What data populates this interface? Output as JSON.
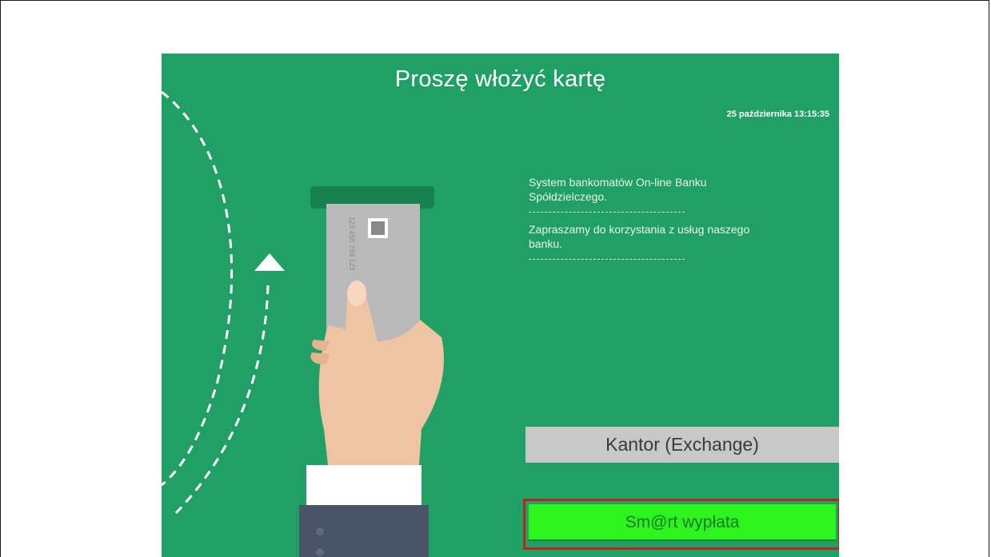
{
  "screen": {
    "title": "Proszę włożyć kartę",
    "datetime": "25 października 13:15:35",
    "info_line1": "System bankomatów On-line Banku Spółdzielczego.",
    "info_line2": "Zapraszamy do korzystania z usług naszego banku.",
    "card_number": "123 456 789 123"
  },
  "buttons": {
    "exchange_label": "Kantor (Exchange)",
    "smart_label": "Sm@rt wypłata"
  },
  "colors": {
    "screen_bg": "#21a065",
    "exchange_button": "#c8c8c8",
    "smart_button": "#2df41d",
    "highlight_outline": "#c0221e"
  }
}
